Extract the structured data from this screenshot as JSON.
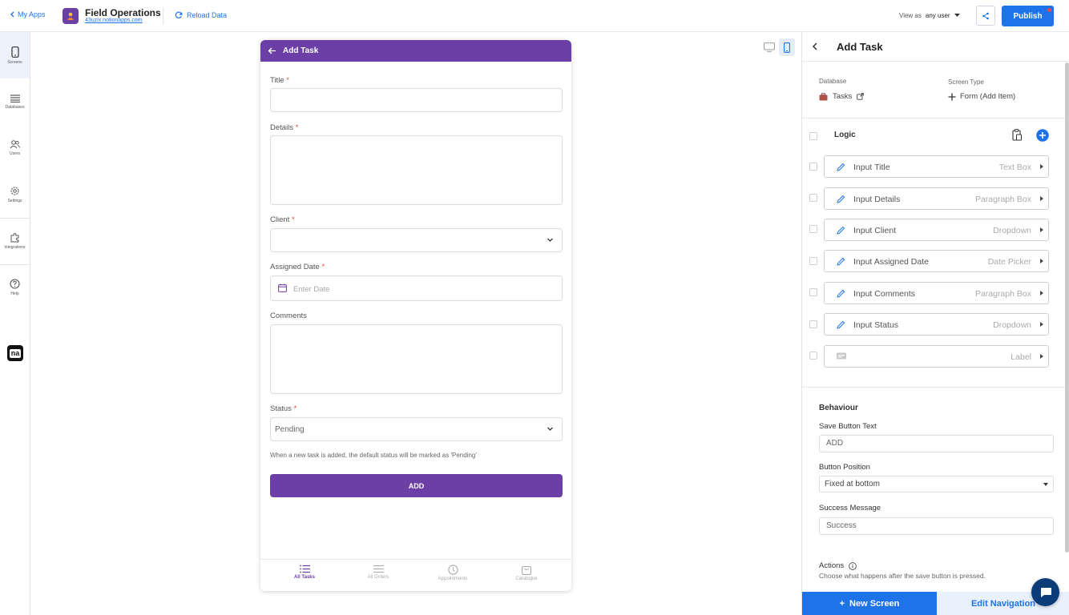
{
  "topbar": {
    "back_label": "My Apps",
    "app_name": "Field Operations",
    "app_url": "43uzix.notionapps.com",
    "reload_label": "Reload Data",
    "view_as_prefix": "View as",
    "view_as_value": "any user",
    "publish_label": "Publish"
  },
  "leftnav": {
    "items": [
      {
        "label": "Screens",
        "icon": "phone-icon"
      },
      {
        "label": "Databases",
        "icon": "list-icon"
      },
      {
        "label": "Users",
        "icon": "users-icon"
      },
      {
        "label": "Settings",
        "icon": "gear-icon"
      },
      {
        "label": "Integrations",
        "icon": "puzzle-icon"
      },
      {
        "label": "Help",
        "icon": "help-icon"
      }
    ],
    "logo_text": "na"
  },
  "phone": {
    "header_title": "Add Task",
    "fields": {
      "title_label": "Title",
      "details_label": "Details",
      "client_label": "Client",
      "assigned_date_label": "Assigned Date",
      "assigned_date_placeholder": "Enter Date",
      "comments_label": "Comments",
      "status_label": "Status",
      "status_value": "Pending",
      "required_mark": "*"
    },
    "hint": "When a new task is added, the default status will be marked as 'Pending'",
    "add_button": "ADD",
    "tabs": [
      {
        "label": "All Tasks",
        "icon": "list-icon"
      },
      {
        "label": "All Orders",
        "icon": "menu-icon"
      },
      {
        "label": "Appointments",
        "icon": "clock-icon"
      },
      {
        "label": "Catalogue",
        "icon": "bag-icon"
      }
    ]
  },
  "panel": {
    "title": "Add Task",
    "database_caption": "Database",
    "database_value": "Tasks",
    "screen_type_caption": "Screen Type",
    "screen_type_value": "Form (Add Item)",
    "logic_label": "Logic",
    "components": [
      {
        "name": "Input Title",
        "type": "Text Box"
      },
      {
        "name": "Input Details",
        "type": "Paragraph Box"
      },
      {
        "name": "Input Client",
        "type": "Dropdown"
      },
      {
        "name": "Input Assigned Date",
        "type": "Date Picker"
      },
      {
        "name": "Input Comments",
        "type": "Paragraph Box"
      },
      {
        "name": "Input Status",
        "type": "Dropdown"
      },
      {
        "name": "",
        "type": "Label"
      }
    ],
    "behaviour_label": "Behaviour",
    "save_button_text_label": "Save Button Text",
    "save_button_text_value": "ADD",
    "button_position_label": "Button Position",
    "button_position_value": "Fixed at bottom",
    "success_message_label": "Success Message",
    "success_message_value": "Success",
    "actions_label": "Actions",
    "actions_desc": "Choose what happens after the save button is pressed.",
    "new_screen_label": "New Screen",
    "edit_navigation_label": "Edit Navigation"
  },
  "colors": {
    "brand_purple": "#6b3fa6",
    "accent_blue": "#1e73e8",
    "required_red": "#e04848"
  }
}
